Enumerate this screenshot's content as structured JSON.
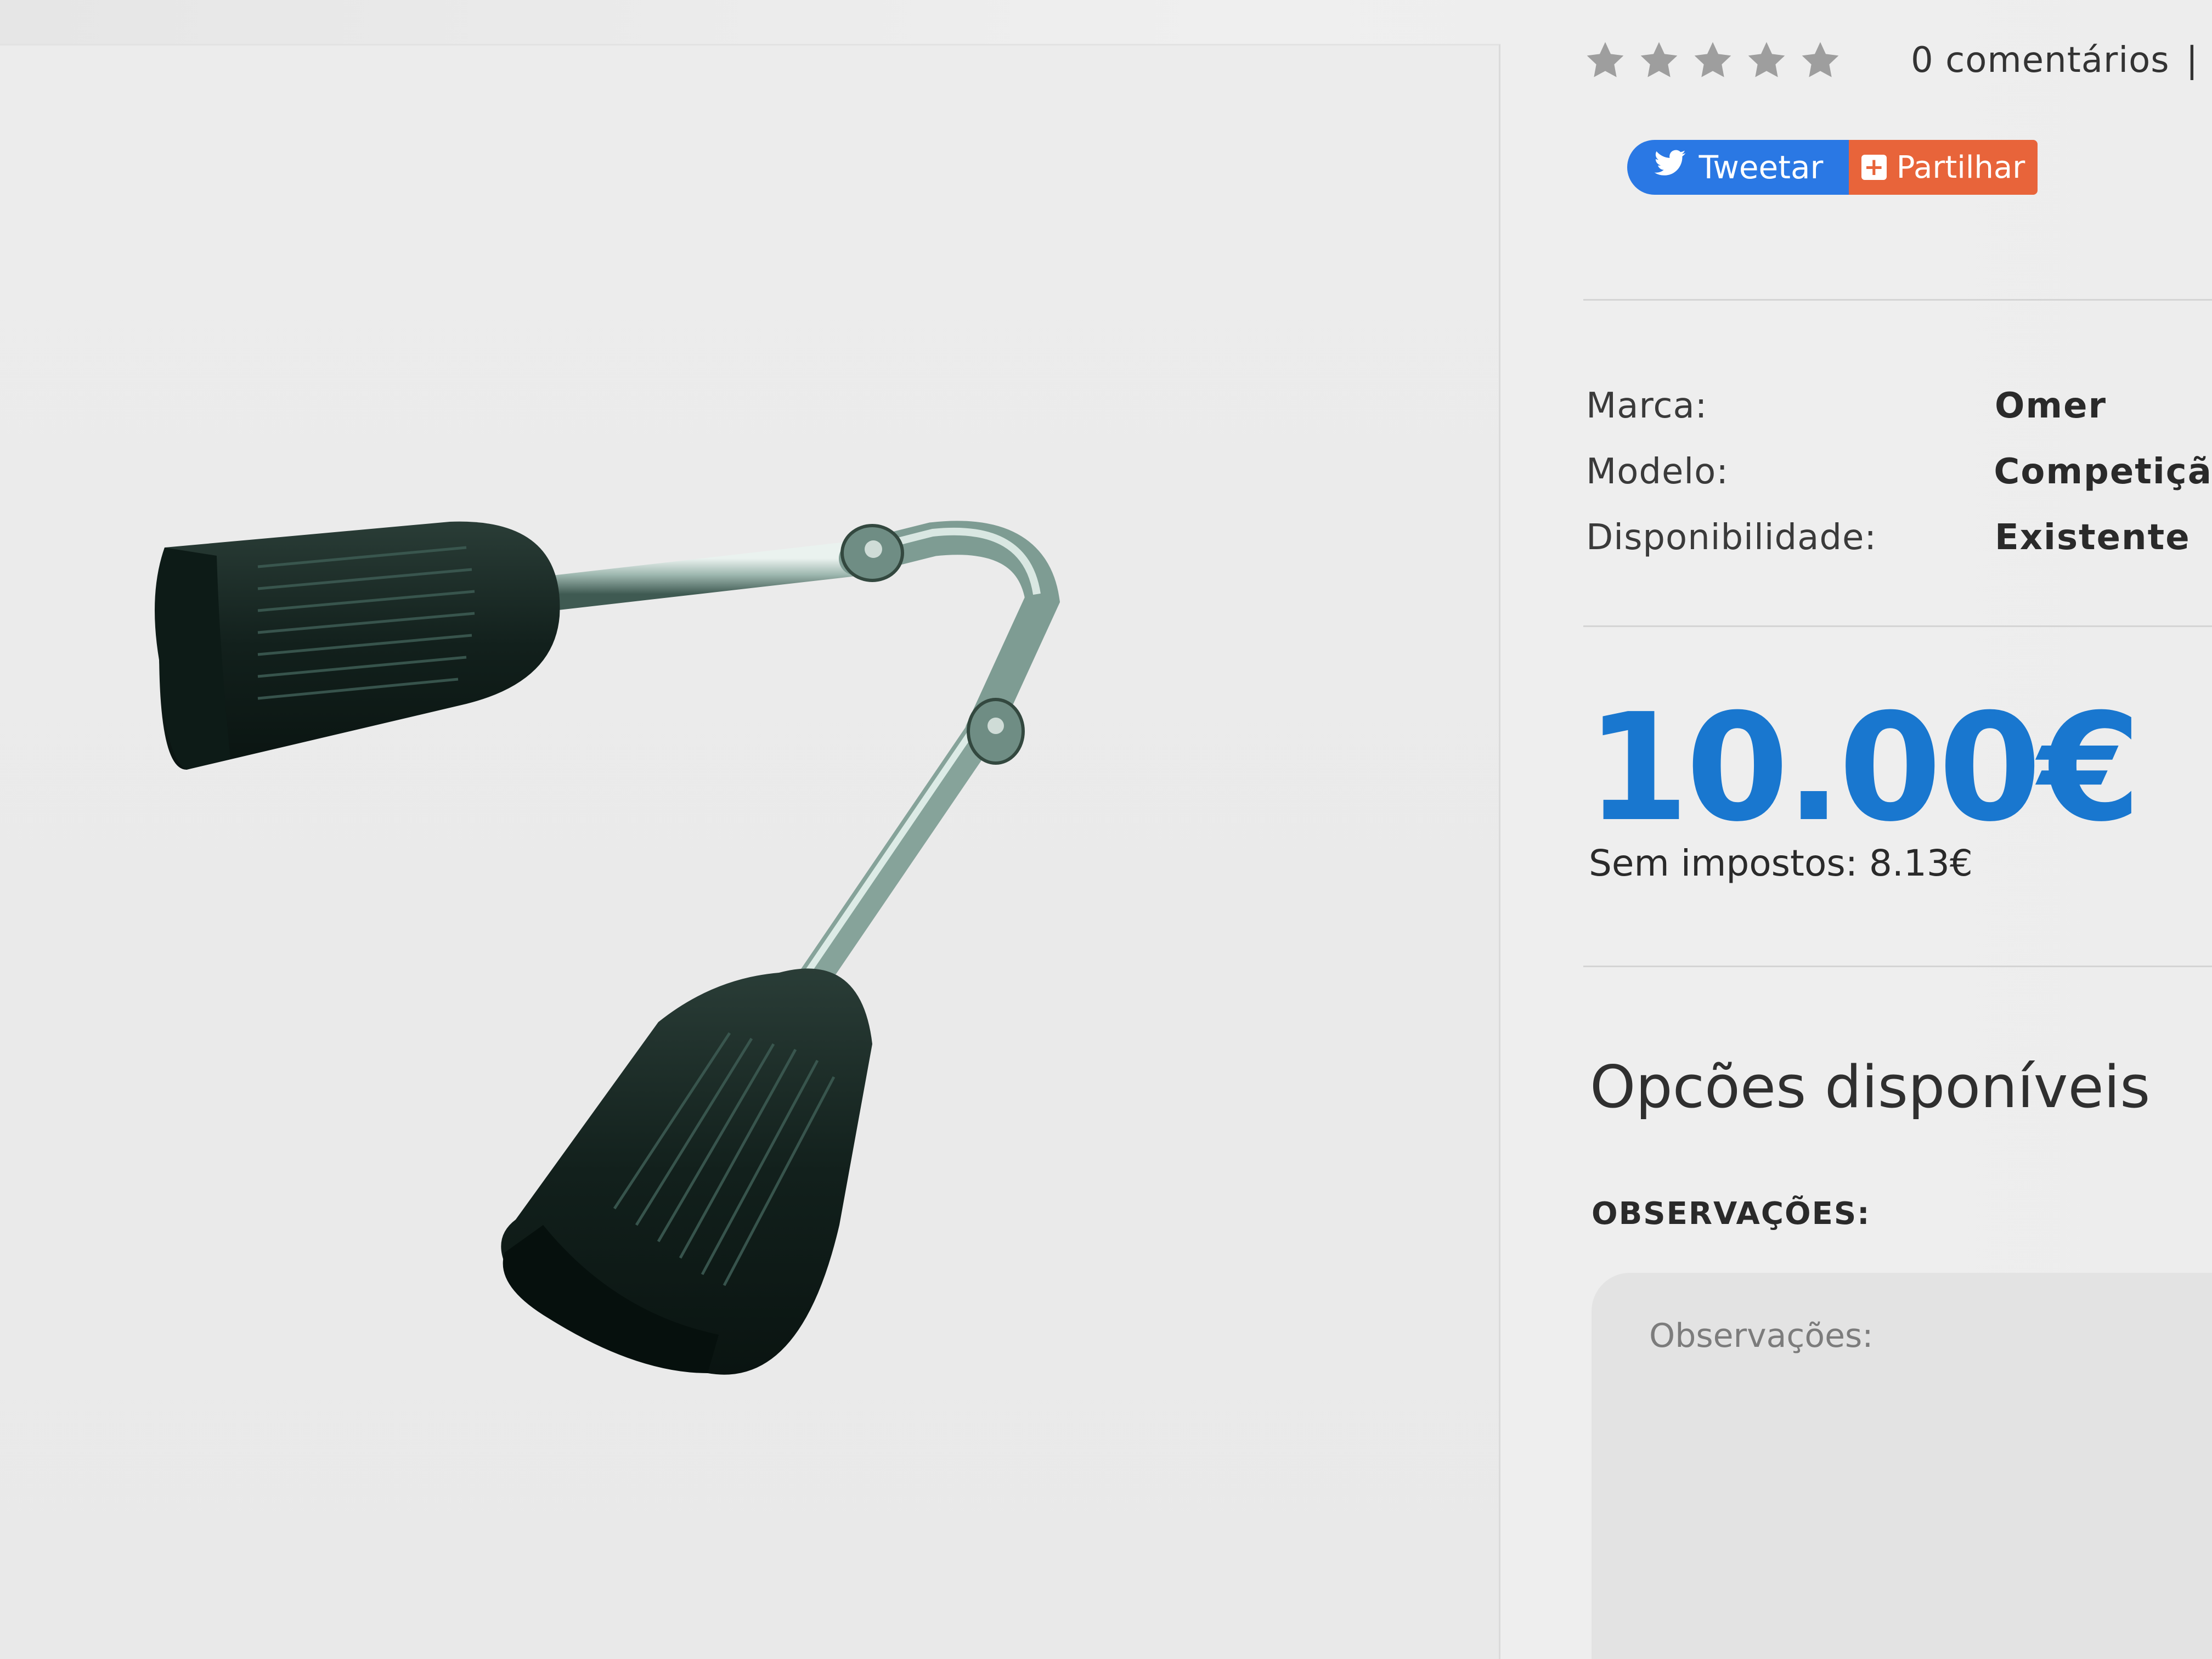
{
  "rating": {
    "stars_total": 5,
    "stars_filled": 0,
    "reviews_label": "0 comentários",
    "separator": "|"
  },
  "share": {
    "tweet_label": "Tweetar",
    "share_label": "Partilhar"
  },
  "specs": [
    {
      "label": "Marca:",
      "value": "Omer"
    },
    {
      "label": "Modelo:",
      "value": "Competiçã"
    },
    {
      "label": "Disponibilidade:",
      "value": "Existente"
    }
  ],
  "price": {
    "amount": "10.00€",
    "tax_label": "Sem impostos: 8.13€"
  },
  "options": {
    "title": "Opcões disponíveis",
    "observations_label": "OBSERVAÇÕES:",
    "observations_placeholder": "Observações:"
  },
  "colors": {
    "price": "#1977cf",
    "tweet": "#2a78e4",
    "share": "#e8643a",
    "star": "#9e9e9e"
  },
  "icons": {
    "star": "star-icon",
    "twitter": "twitter-bird-icon",
    "share": "plus-box-icon"
  }
}
